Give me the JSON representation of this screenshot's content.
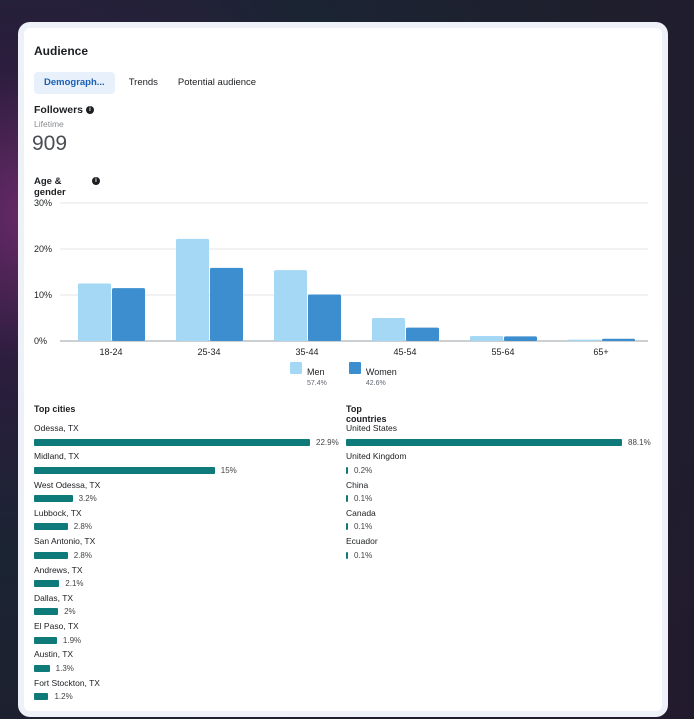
{
  "section_title": "Audience",
  "tabs": [
    "Demograph...",
    "Trends",
    "Potential audience"
  ],
  "followers": {
    "label": "Followers",
    "period": "Lifetime",
    "count": "909"
  },
  "age_gender_label": "Age & gender",
  "chart_data": {
    "type": "bar",
    "categories": [
      "18-24",
      "25-34",
      "35-44",
      "45-54",
      "55-64",
      "65+"
    ],
    "series": [
      {
        "name": "Men",
        "values": [
          12.5,
          22.2,
          15.4,
          5.0,
          1.1,
          0.3
        ]
      },
      {
        "name": "Women",
        "values": [
          11.5,
          15.9,
          10.1,
          2.9,
          1.0,
          0.5
        ]
      }
    ],
    "yticks": [
      "0%",
      "10%",
      "20%",
      "30%"
    ],
    "ylim": [
      0,
      30
    ],
    "grid": true,
    "colors": {
      "Men": "#a5d8f5",
      "Women": "#3d8ecf"
    }
  },
  "legend": [
    {
      "name": "Men",
      "pct": "57.4%",
      "color": "#a5d8f5"
    },
    {
      "name": "Women",
      "pct": "42.6%",
      "color": "#3d8ecf"
    }
  ],
  "top_cities": {
    "title": "Top cities",
    "items": [
      {
        "name": "Odessa, TX",
        "value": "22.9%",
        "pct": 22.9
      },
      {
        "name": "Midland, TX",
        "value": "15%",
        "pct": 15
      },
      {
        "name": "West Odessa, TX",
        "value": "3.2%",
        "pct": 3.2
      },
      {
        "name": "Lubbock, TX",
        "value": "2.8%",
        "pct": 2.8
      },
      {
        "name": "San Antonio, TX",
        "value": "2.8%",
        "pct": 2.8
      },
      {
        "name": "Andrews, TX",
        "value": "2.1%",
        "pct": 2.1
      },
      {
        "name": "Dallas, TX",
        "value": "2%",
        "pct": 2
      },
      {
        "name": "El Paso, TX",
        "value": "1.9%",
        "pct": 1.9
      },
      {
        "name": "Austin, TX",
        "value": "1.3%",
        "pct": 1.3
      },
      {
        "name": "Fort Stockton, TX",
        "value": "1.2%",
        "pct": 1.2
      }
    ]
  },
  "top_countries": {
    "title": "Top countries",
    "items": [
      {
        "name": "United States",
        "value": "88.1%",
        "pct": 88.1
      },
      {
        "name": "United Kingdom",
        "value": "0.2%",
        "pct": 0.2
      },
      {
        "name": "China",
        "value": "0.1%",
        "pct": 0.1
      },
      {
        "name": "Canada",
        "value": "0.1%",
        "pct": 0.1
      },
      {
        "name": "Ecuador",
        "value": "0.1%",
        "pct": 0.1
      }
    ]
  }
}
